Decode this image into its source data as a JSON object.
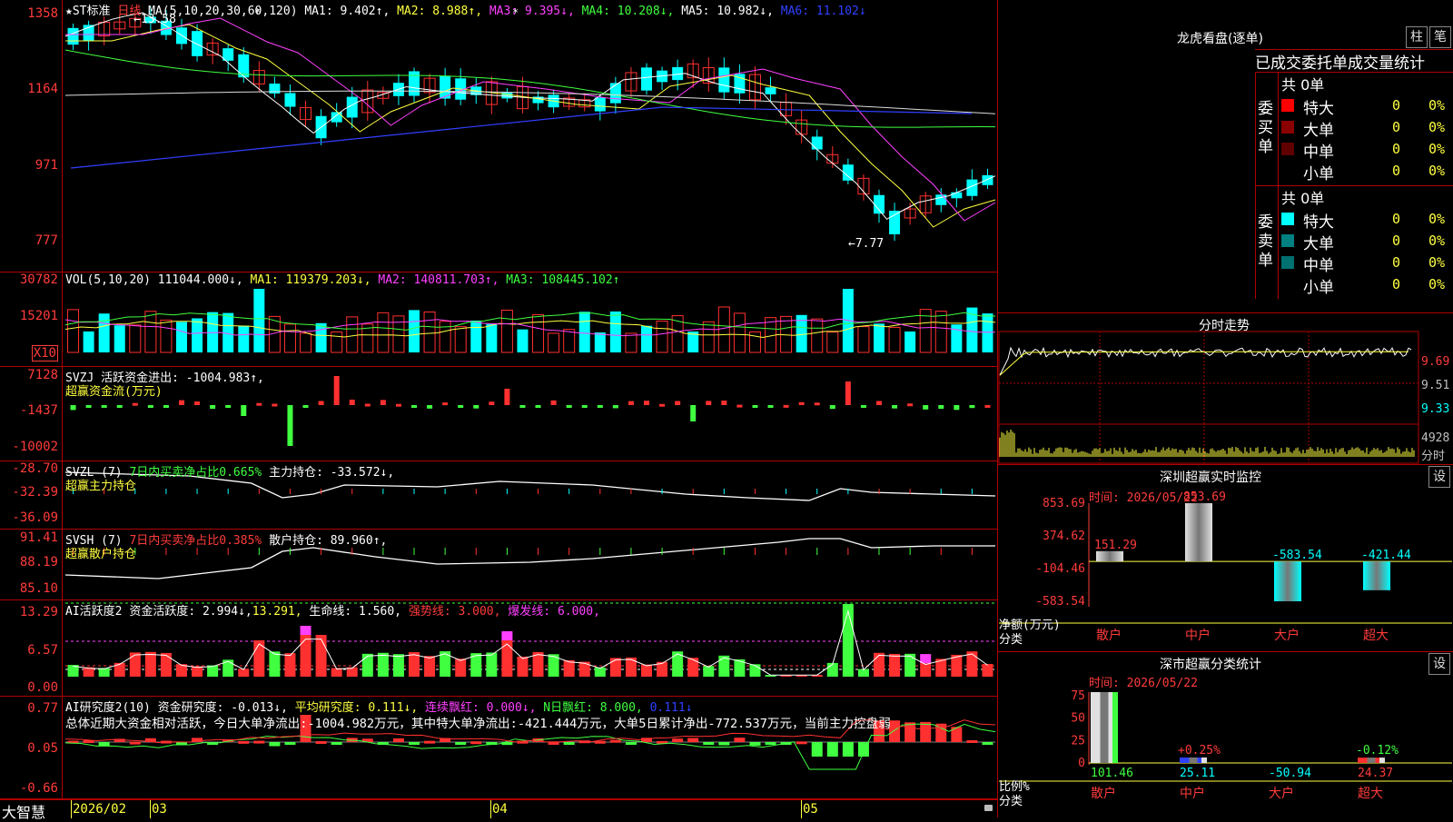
{
  "colors": {
    "up": "#ff3030",
    "down": "#00ffff",
    "grid": "#b00000",
    "yellow": "#ffff40",
    "magenta": "#ff40ff",
    "green": "#40ff40",
    "blue": "#3040ff",
    "white": "#ffffff"
  },
  "price": {
    "star": "★",
    "stock": "ST标准",
    "period": "日线",
    "ma_label": "MA(5,10,20,30,60,120)",
    "ma1": "MA1: 9.402↑,",
    "ma2": "MA2: 8.988↑,",
    "ma3": "MA3: 9.395↓,",
    "ma4": "MA4: 10.208↓,",
    "ma5": "MA5: 10.982↓,",
    "ma6": "MA6: 11.102↓",
    "high_label": "←13.58",
    "low_label": "←7.77",
    "yticks": [
      "1358",
      "1164",
      "971",
      "777"
    ]
  },
  "vol": {
    "label": "VOL(5,10,20)",
    "value": "111044.000↓,",
    "ma1": "MA1: 119379.203↓,",
    "ma2": "MA2: 140811.703↑,",
    "ma3": "MA3: 108445.102↑",
    "yticks": [
      "30782",
      "15201"
    ],
    "unit": "X10"
  },
  "svzj": {
    "label": "SVZJ",
    "line1": "活跃资金进出: -1004.983↑,",
    "line2": "超赢资金流(万元)",
    "yticks": [
      "7128",
      "-1437",
      "-10002"
    ]
  },
  "svzl": {
    "label": "SVZL (7)",
    "seg1": "7日内买卖净占比0.665%",
    "seg2": "主力持仓: -33.572↓,",
    "line2": "超赢主力持仓",
    "yticks": [
      "-28.70",
      "-32.39",
      "-36.09"
    ]
  },
  "svsh": {
    "label": "SVSH (7)",
    "seg1": "7日内买卖净占比0.385%",
    "seg2": "散户持仓: 89.960↑,",
    "line2": "超赢散户持仓",
    "yticks": [
      "91.41",
      "88.19",
      "85.10"
    ]
  },
  "ai1": {
    "label": "AI活跃度2",
    "seg1": "资金活跃度: 2.994↓,",
    "seg2": "13.291,",
    "seg3": "生命线: 1.560,",
    "seg4": "强势线: 3.000,",
    "seg5": "爆发线: 6.000,",
    "yticks": [
      "13.29",
      "6.57",
      "0.00"
    ]
  },
  "ai2": {
    "label": "AI研究度2(10)",
    "seg1": "资金研究度: -0.013↓,",
    "seg2": "平均研究度: 0.111↓,",
    "seg3": "连续飘红: 0.000↓,",
    "seg4": "N日飘红: 8.000,",
    "seg5": "0.111↓",
    "summary": "总体近期大资金相对活跃，今日大单净流出:-1004.982万元，其中特大单净流出:-421.444万元，大单5日累计净出-772.537万元，当前主力控盘弱",
    "yticks": [
      "0.77",
      "0.05",
      "-0.66"
    ]
  },
  "bottom": {
    "brand": "大智慧",
    "dates": [
      "2026/02",
      "03",
      "04",
      "05"
    ]
  },
  "lhb": {
    "title": "龙虎看盘(逐单)",
    "btn_bar": "柱",
    "btn_pen": "笔",
    "tabs": [
      "已成交",
      "委托单",
      "成交量统计"
    ],
    "buy": {
      "side_label": "委买单",
      "total": "共 0单",
      "rows": [
        {
          "name": "特大",
          "v": "0",
          "p": "0%",
          "color": "#ff0000"
        },
        {
          "name": "大单",
          "v": "0",
          "p": "0%",
          "color": "#8b0000"
        },
        {
          "name": "中单",
          "v": "0",
          "p": "0%",
          "color": "#600000"
        },
        {
          "name": "小单",
          "v": "0",
          "p": "0%",
          "color": ""
        }
      ]
    },
    "sell": {
      "side_label": "委卖单",
      "total": "共 0单",
      "rows": [
        {
          "name": "特大",
          "v": "0",
          "p": "0%",
          "color": "#00ffff"
        },
        {
          "name": "大单",
          "v": "0",
          "p": "0%",
          "color": "#008080"
        },
        {
          "name": "中单",
          "v": "0",
          "p": "0%",
          "color": "#007070"
        },
        {
          "name": "小单",
          "v": "0",
          "p": "0%",
          "color": ""
        }
      ]
    }
  },
  "fs": {
    "title": "分时走势",
    "yticks": [
      "9.69",
      "9.51",
      "9.33"
    ],
    "vol_tick": "4928",
    "vol_unit": "分时"
  },
  "sz_monitor": {
    "title": "深圳超赢实时监控",
    "btn": "设",
    "time": "时间: 2026/05/22",
    "yticks": [
      "853.69",
      "374.62",
      "-104.46",
      "-583.54"
    ],
    "ylabel": "净额(万元)",
    "xlabel": "分类",
    "cats": [
      "散户",
      "中户",
      "大户",
      "超大"
    ],
    "values": [
      "151.29",
      "853.69",
      "-583.54",
      "-421.44"
    ]
  },
  "sz_class": {
    "title": "深市超赢分类统计",
    "btn": "设",
    "time": "时间: 2026/05/22",
    "yticks": [
      "75",
      "50",
      "25",
      "0"
    ],
    "ylabel": "比例%",
    "xlabel": "分类",
    "cats": [
      "散户",
      "中户",
      "大户",
      "超大"
    ],
    "top_labels": [
      "",
      "+0.25%",
      "",
      "-0.12%"
    ],
    "values": [
      "101.46",
      "25.11",
      "-50.94",
      "24.37"
    ]
  },
  "chart_data": [
    {
      "type": "bar",
      "title": "深圳超赢实时监控",
      "ylabel": "净额(万元)",
      "xlabel": "分类",
      "categories": [
        "散户",
        "中户",
        "大户",
        "超大"
      ],
      "values": [
        151.29,
        853.69,
        -583.54,
        -421.44
      ],
      "ylim": [
        -583.54,
        853.69
      ]
    },
    {
      "type": "bar",
      "title": "深市超赢分类统计",
      "ylabel": "比例%",
      "xlabel": "分类",
      "categories": [
        "散户",
        "中户",
        "大户",
        "超大"
      ],
      "values": [
        101.46,
        25.11,
        -50.94,
        24.37
      ],
      "ylim": [
        0,
        75
      ]
    }
  ]
}
